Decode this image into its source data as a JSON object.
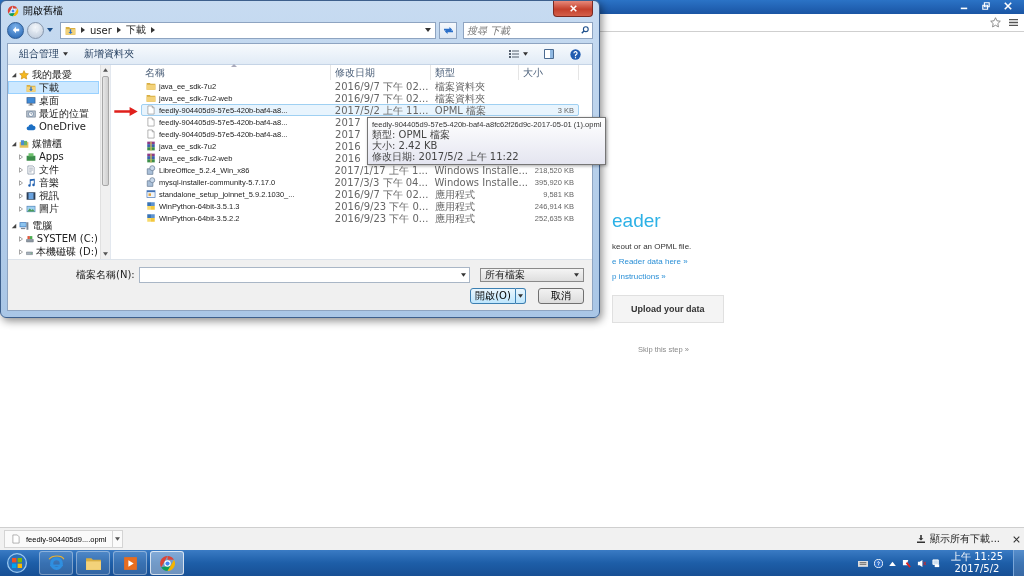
{
  "dialog": {
    "title": "開啟舊檔",
    "path": [
      "user",
      "下載"
    ],
    "search": {
      "placeholder": "搜尋 下載"
    },
    "toolbar": {
      "organize": "組合管理",
      "new_folder": "新增資料夾"
    },
    "sidebar": [
      {
        "label": "我的最愛",
        "kind": "star",
        "expanded": true,
        "selected": false,
        "children": [
          {
            "label": "下載",
            "kind": "downloads",
            "selected": true
          },
          {
            "label": "桌面",
            "kind": "desktop",
            "selected": false
          },
          {
            "label": "最近的位置",
            "kind": "recent",
            "selected": false
          },
          {
            "label": "OneDrive",
            "kind": "cloud",
            "selected": false
          }
        ]
      },
      {
        "label": "媒體櫃",
        "kind": "library",
        "expanded": true,
        "selected": false,
        "children": [
          {
            "label": "Apps",
            "kind": "apps",
            "expanded": false,
            "selected": false
          },
          {
            "label": "文件",
            "kind": "documents",
            "expanded": false,
            "selected": false
          },
          {
            "label": "音樂",
            "kind": "music",
            "expanded": false,
            "selected": false
          },
          {
            "label": "視訊",
            "kind": "video",
            "expanded": false,
            "selected": false
          },
          {
            "label": "圖片",
            "kind": "pictures",
            "expanded": false,
            "selected": false
          }
        ]
      },
      {
        "label": "電腦",
        "kind": "computer",
        "expanded": true,
        "selected": false,
        "children": [
          {
            "label": "SYSTEM (C:)",
            "kind": "system_drive",
            "expanded": false,
            "selected": false
          },
          {
            "label": "本機磁碟 (D:)",
            "kind": "drive",
            "expanded": false,
            "selected": false
          }
        ]
      }
    ],
    "columns": [
      "名稱",
      "修改日期",
      "類型",
      "大小"
    ],
    "rows": [
      {
        "name": "java_ee_sdk-7u2",
        "date": "2016/9/7 下午 02...",
        "type": "檔案資料夾",
        "kind": "folder",
        "hovered": false
      },
      {
        "name": "java_ee_sdk-7u2-web",
        "date": "2016/9/7 下午 02...",
        "type": "檔案資料夾",
        "kind": "folder",
        "hovered": false
      },
      {
        "name": "feedly-904405d9-57e5-420b-baf4-a8...",
        "date": "2017/5/2 上午 11...",
        "type": "OPML 檔案",
        "size": "3 KB",
        "kind": "document",
        "hovered": true
      },
      {
        "name": "feedly-904405d9-57e5-420b-baf4-a8...",
        "date": "2017",
        "kind": "document",
        "hovered": false
      },
      {
        "name": "feedly-904405d9-57e5-420b-baf4-a8...",
        "date": "2017",
        "kind": "document",
        "hovered": false
      },
      {
        "name": "java_ee_sdk-7u2",
        "date": "2016",
        "kind": "archive",
        "hovered": false
      },
      {
        "name": "java_ee_sdk-7u2-web",
        "date": "2016",
        "kind": "archive",
        "hovered": false
      },
      {
        "name": "LibreOffice_5.2.4_Win_x86",
        "date": "2017/1/17 上午 1...",
        "type": "Windows Installe...",
        "size": "218,520 KB",
        "kind": "installer",
        "hovered": false
      },
      {
        "name": "mysql-installer-community-5.7.17.0",
        "date": "2017/3/3 下午 04...",
        "type": "Windows Installe...",
        "size": "395,920 KB",
        "kind": "installer",
        "hovered": false
      },
      {
        "name": "standalone_setup_joinnet_5.9.2.1030_...",
        "date": "2016/9/7 下午 02...",
        "type": "應用程式",
        "size": "9,581 KB",
        "kind": "program",
        "hovered": false
      },
      {
        "name": "WinPython-64bit-3.5.1.3",
        "date": "2016/9/23 下午 0...",
        "type": "應用程式",
        "size": "246,914 KB",
        "kind": "python",
        "hovered": false
      },
      {
        "name": "WinPython-64bit-3.5.2.2",
        "date": "2016/9/23 下午 0...",
        "type": "應用程式",
        "size": "252,635 KB",
        "kind": "python",
        "hovered": false
      }
    ],
    "tooltip": {
      "name": "feedly-904405d9-57e5-420b-baf4-a8fc62f26d9c-2017-05-01 (1).opml",
      "lines": [
        "類型: OPML 檔案",
        "大小: 2.42 KB",
        "修改日期: 2017/5/2 上午 11:22"
      ]
    },
    "filename_label": "檔案名稱(N):",
    "filter": "所有檔案",
    "open_button": "開啟(O)",
    "cancel_button": "取消"
  },
  "page": {
    "heading": "eader",
    "text": "keout or an OPML file.",
    "links": [
      "e Reader data here »",
      "p instructions »"
    ],
    "upload_button": "Upload your data",
    "skip_link": "Skip this step »"
  },
  "download_bar": {
    "items": [
      {
        "name": "feedly-904405d9....opml"
      }
    ],
    "show_all": "顯示所有下載..."
  },
  "taskbar": {
    "apps": [
      {
        "kind": "ie",
        "selected": false
      },
      {
        "kind": "explorer",
        "selected": false
      },
      {
        "kind": "player",
        "selected": false
      },
      {
        "kind": "chrome",
        "selected": true
      }
    ],
    "time": "上午 11:25",
    "date": "2017/5/2"
  }
}
